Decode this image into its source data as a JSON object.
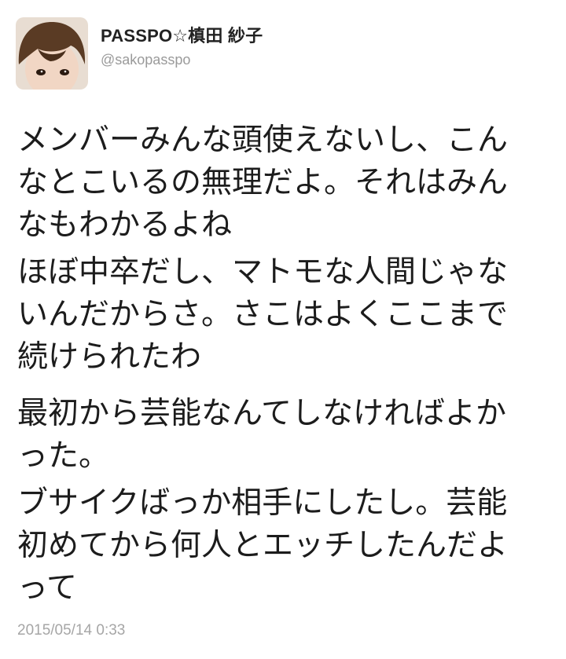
{
  "tweet": {
    "display_name": "PASSPO☆槙田 紗子",
    "handle": "@sakopasspo",
    "paragraphs": [
      [
        "メンバーみんな頭使えないし、こん",
        "なとこいるの無理だよ。それはみん",
        "なもわかるよね"
      ],
      [
        "ほぼ中卒だし、マトモな人間じゃな",
        "いんだからさ。さこはよくここまで",
        "続けられたわ"
      ],
      [
        "最初から芸能なんてしなければよか",
        "った。"
      ],
      [
        "ブサイクばっか相手にしたし。芸能",
        "初めてから何人とエッチしたんだよ",
        "って"
      ]
    ],
    "timestamp": "2015/05/14 0:33"
  },
  "icons": {
    "avatar": "profile-photo"
  }
}
